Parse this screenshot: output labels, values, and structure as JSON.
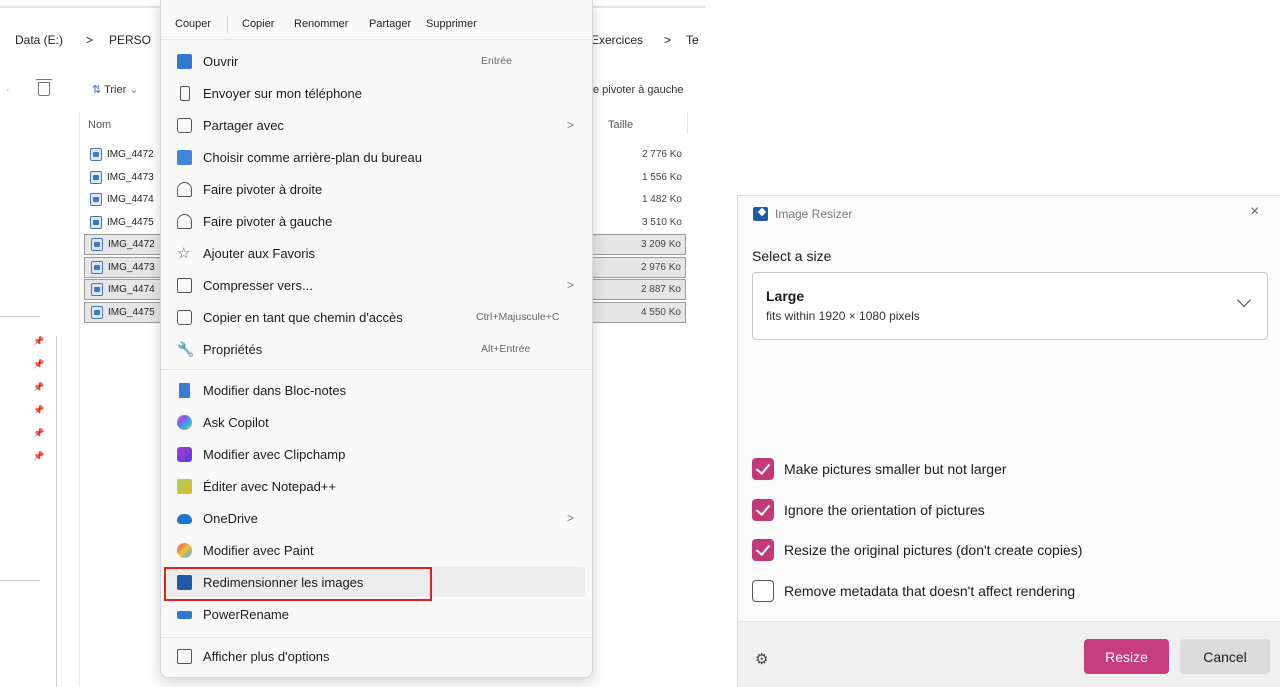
{
  "explorer": {
    "breadcrumb": [
      "Data (E:)",
      ">",
      "PERSO"
    ],
    "breadcrumb_right": [
      "Exercices",
      ">",
      "Te"
    ],
    "toolbar": {
      "sort_label": "Trier",
      "rotate_left_label": "e pivoter à gauche"
    },
    "columns": {
      "name": "Nom",
      "size": "Taille"
    },
    "files": [
      {
        "name": "IMG_4472",
        "size": "2 776 Ko",
        "selected": false
      },
      {
        "name": "IMG_4473",
        "size": "1 556 Ko",
        "selected": false
      },
      {
        "name": "IMG_4474",
        "size": "1 482 Ko",
        "selected": false
      },
      {
        "name": "IMG_4475",
        "size": "3 510 Ko",
        "selected": false
      },
      {
        "name": "IMG_4472",
        "size": "3 209 Ko",
        "selected": true
      },
      {
        "name": "IMG_4473",
        "size": "2 976 Ko",
        "selected": true
      },
      {
        "name": "IMG_4474",
        "size": "2 887 Ko",
        "selected": true
      },
      {
        "name": "IMG_4475",
        "size": "4 550 Ko",
        "selected": true
      }
    ]
  },
  "context_menu": {
    "actions": [
      "Couper",
      "Copier",
      "Renommer",
      "Partager",
      "Supprimer"
    ],
    "items": [
      {
        "label": "Ouvrir",
        "shortcut": "Entrée",
        "icon": "open-image-icon"
      },
      {
        "label": "Envoyer sur mon téléphone",
        "icon": "phone-icon"
      },
      {
        "label": "Partager avec",
        "icon": "share-icon",
        "arrow": ">"
      },
      {
        "label": "Choisir comme arrière-plan du bureau",
        "icon": "wallpaper-icon"
      },
      {
        "label": "Faire pivoter à droite",
        "icon": "rotate-right-icon"
      },
      {
        "label": "Faire pivoter à gauche",
        "icon": "rotate-left-icon"
      },
      {
        "label": "Ajouter aux Favoris",
        "icon": "star-icon"
      },
      {
        "label": "Compresser vers...",
        "icon": "zip-icon",
        "arrow": ">"
      },
      {
        "label": "Copier en tant que chemin d'accès",
        "shortcut": "Ctrl+Majuscule+C",
        "icon": "copy-path-icon"
      },
      {
        "label": "Propriétés",
        "shortcut": "Alt+Entrée",
        "icon": "wrench-icon"
      },
      {
        "label": "Modifier dans Bloc-notes",
        "icon": "notepad-icon"
      },
      {
        "label": "Ask Copilot",
        "icon": "copilot-icon"
      },
      {
        "label": "Modifier avec Clipchamp",
        "icon": "clipchamp-icon"
      },
      {
        "label": "Éditer avec Notepad++",
        "icon": "notepadpp-icon"
      },
      {
        "label": "OneDrive",
        "icon": "onedrive-icon",
        "arrow": ">"
      },
      {
        "label": "Modifier avec Paint",
        "icon": "paint-icon"
      },
      {
        "label": "Redimensionner les images",
        "icon": "image-resizer-icon"
      },
      {
        "label": "PowerRename",
        "icon": "powerrename-icon"
      },
      {
        "label": "Afficher plus d'options",
        "icon": "more-options-icon"
      }
    ]
  },
  "dialog": {
    "title": "Image Resizer",
    "close_glyph": "×",
    "select_label": "Select a size",
    "size_name": "Large",
    "size_desc": "fits within 1920 × 1080 pixels",
    "options": [
      {
        "label": "Make pictures smaller but not larger",
        "checked": true
      },
      {
        "label": "Ignore the orientation of pictures",
        "checked": true
      },
      {
        "label": "Resize the original pictures (don't create copies)",
        "checked": true
      },
      {
        "label": "Remove metadata that doesn't affect rendering",
        "checked": false
      }
    ],
    "resize_label": "Resize",
    "cancel_label": "Cancel",
    "accent": "#c2397a"
  }
}
